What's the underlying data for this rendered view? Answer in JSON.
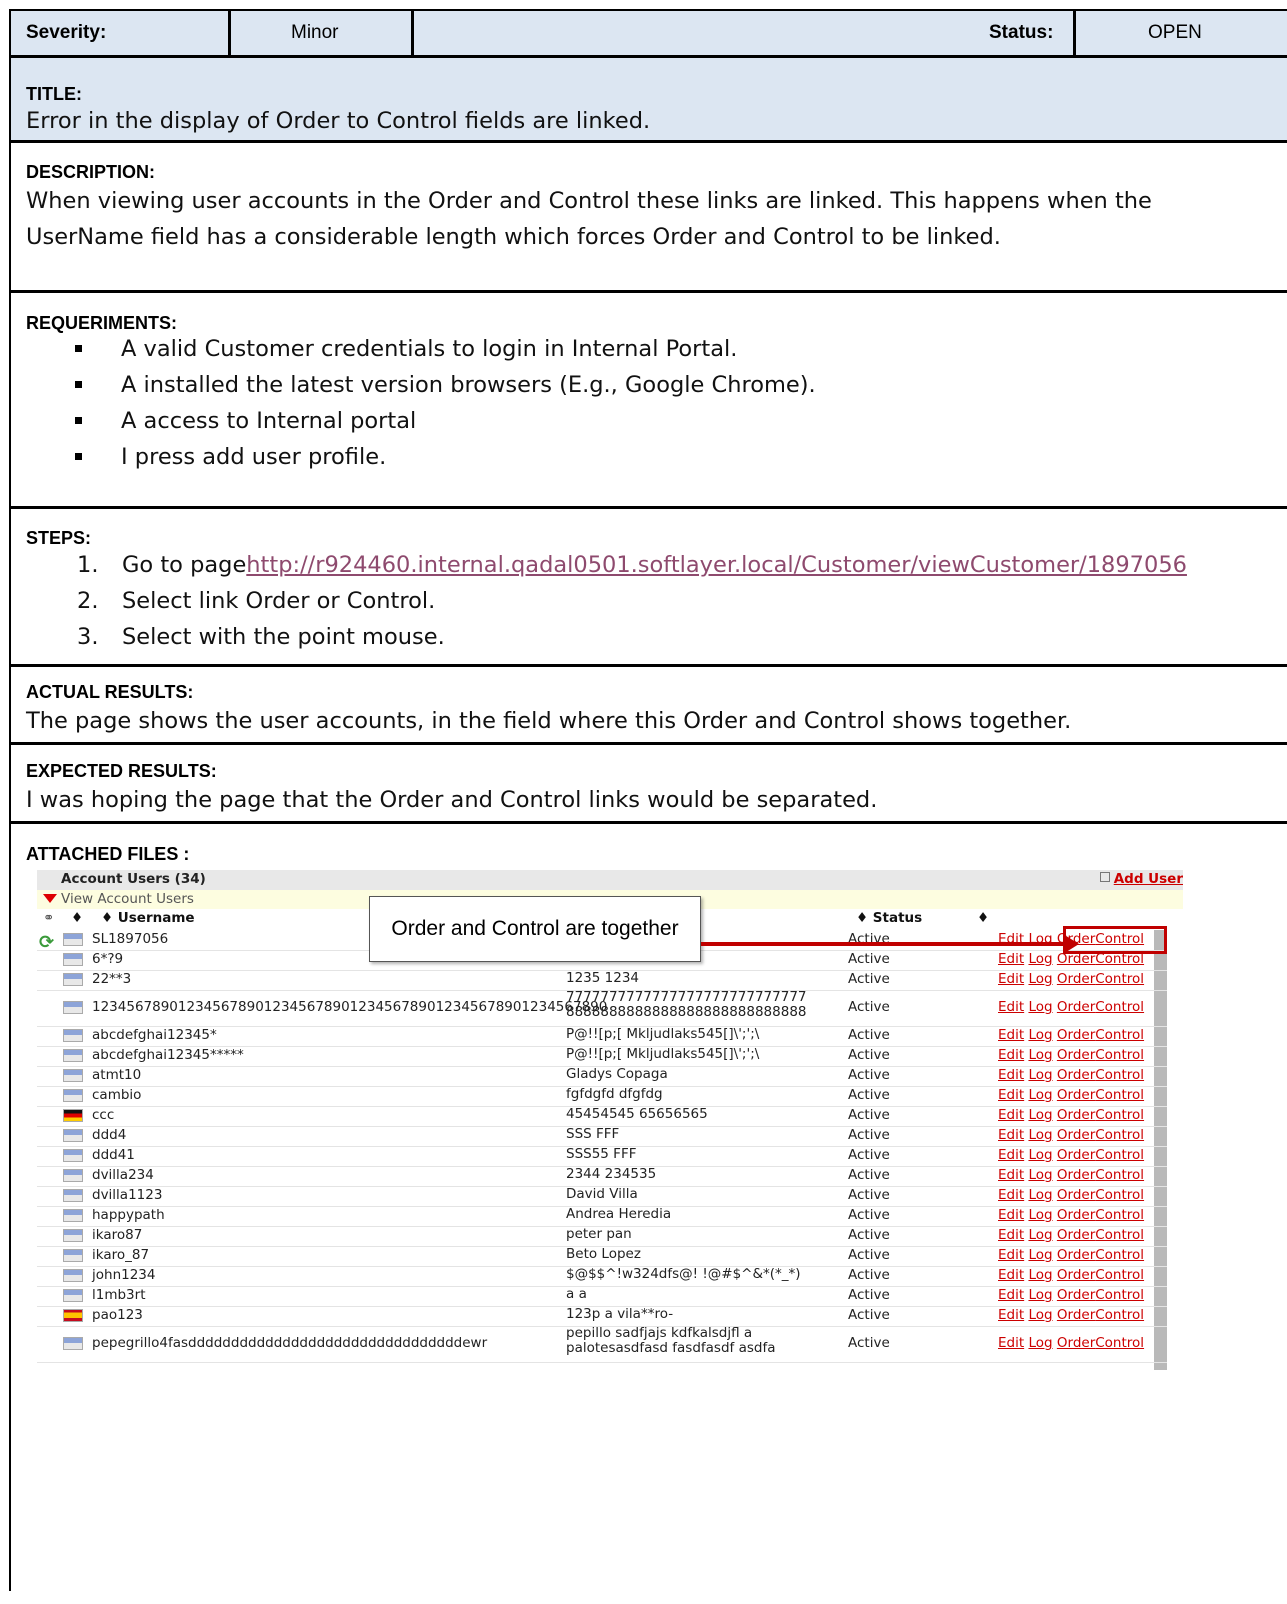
{
  "header": {
    "severity_label": "Severity:",
    "severity_value": "Minor",
    "status_label": "Status:",
    "status_value": "OPEN"
  },
  "title": {
    "label": "TITLE:",
    "text": "Error in the display of Order to Control fields are linked."
  },
  "description": {
    "label": "DESCRIPTION:",
    "line1": "When viewing user accounts in the Order and Control these links are linked. This happens when the",
    "line2": "UserName field has a considerable length which forces Order and Control to be linked."
  },
  "requirements": {
    "label": "REQUERIMENTS:",
    "items": [
      "A valid Customer credentials to login in Internal Portal.",
      "A installed the latest version browsers (E.g., Google Chrome).",
      "A access to Internal portal",
      "I press add user profile."
    ]
  },
  "steps": {
    "label": "STEPS:",
    "items": [
      {
        "num": "1.",
        "text": "Go to page",
        "link": "http://r924460.internal.qadal0501.softlayer.local/Customer/viewCustomer/1897056"
      },
      {
        "num": "2.",
        "text": "Select link Order or Control."
      },
      {
        "num": "3.",
        "text": "Select with the point mouse."
      }
    ]
  },
  "actual": {
    "label": "ACTUAL RESULTS:",
    "text": "The page shows the user accounts, in the field where this Order and Control shows together."
  },
  "expected": {
    "label": "EXPECTED RESULTS:",
    "text": "I was hoping the page that the Order and Control links would be separated."
  },
  "attached": {
    "label": "ATTACHED FILES :",
    "screenshot": {
      "panel_title": "Account Users (34)",
      "add_user": "Add User",
      "view_toggle": "View Account Users",
      "col_sort": "♦",
      "col_username": "♦ Username",
      "col_status": "♦ Status",
      "col_sort2": "♦",
      "callout": "Order and Control are together",
      "actions": {
        "edit": "Edit",
        "log": "Log",
        "order": "Order",
        "control": "Control"
      },
      "rows": [
        {
          "username": "SL1897056",
          "name": "",
          "status": "Active",
          "flag": "us"
        },
        {
          "username": "6*?9",
          "name": "",
          "status": "Active",
          "flag": "us"
        },
        {
          "username": "22**3",
          "name": "1235 1234",
          "status": "Active",
          "flag": "us"
        },
        {
          "username": "123456789012345678901234567890123456789012345678901234567890",
          "name": "7777777777777777777777777777",
          "name2": "8888888888888888888888888888",
          "status": "Active",
          "flag": "us"
        },
        {
          "username": "abcdefghai12345*",
          "name": "P@!![p;[ Mkljudlaks545[]\\';';\\",
          "status": "Active",
          "flag": "us"
        },
        {
          "username": "abcdefghai12345*****",
          "name": "P@!![p;[ Mkljudlaks545[]\\';';\\",
          "status": "Active",
          "flag": "us"
        },
        {
          "username": "atmt10",
          "name": "Gladys Copaga",
          "status": "Active",
          "flag": "us"
        },
        {
          "username": "cambio",
          "name": "fgfdgfd dfgfdg",
          "status": "Active",
          "flag": "us"
        },
        {
          "username": "ccc",
          "name": "45454545 65656565",
          "status": "Active",
          "flag": "de"
        },
        {
          "username": "ddd4",
          "name": "SSS FFF",
          "status": "Active",
          "flag": "us"
        },
        {
          "username": "ddd41",
          "name": "SSS55 FFF",
          "status": "Active",
          "flag": "us"
        },
        {
          "username": "dvilla234",
          "name": "2344 234535",
          "status": "Active",
          "flag": "us"
        },
        {
          "username": "dvilla1123",
          "name": "David Villa",
          "status": "Active",
          "flag": "us"
        },
        {
          "username": "happypath",
          "name": "Andrea Heredia",
          "status": "Active",
          "flag": "us"
        },
        {
          "username": "ikaro87",
          "name": "peter pan",
          "status": "Active",
          "flag": "us"
        },
        {
          "username": "ikaro_87",
          "name": "Beto Lopez",
          "status": "Active",
          "flag": "us"
        },
        {
          "username": "john1234",
          "name": "$@$$^!w324dfs@! !@#$^&*(*_*)",
          "status": "Active",
          "flag": "us"
        },
        {
          "username": "l1mb3rt",
          "name": "a a",
          "status": "Active",
          "flag": "us"
        },
        {
          "username": "pao123",
          "name": "123p a vila**ro-",
          "status": "Active",
          "flag": "es"
        },
        {
          "username": "pepegrillo4fasddddddddddddddddddddddddddddddddewr",
          "name": "pepillo sadfjajs kdfkalsdjfl a",
          "name2": "palotesasdfasd fasdfasdf asdfa",
          "status": "Active",
          "flag": "us"
        }
      ]
    }
  }
}
